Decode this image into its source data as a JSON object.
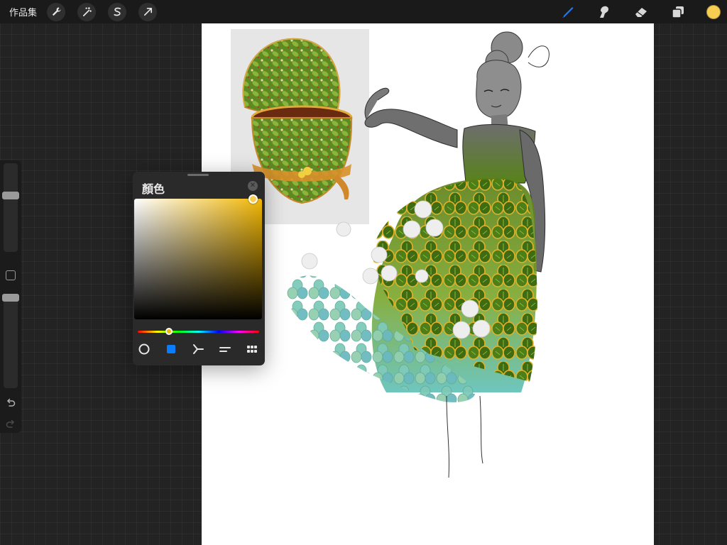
{
  "topbar": {
    "gallery_label": "作品集",
    "left_tools": [
      {
        "name": "wrench-icon",
        "label": "actions"
      },
      {
        "name": "magic-wand-icon",
        "label": "adjustments"
      },
      {
        "name": "selection-s-icon",
        "label": "selection"
      },
      {
        "name": "transform-arrow-icon",
        "label": "transform"
      }
    ],
    "right_tools": [
      {
        "name": "brush-icon",
        "active": true
      },
      {
        "name": "smudge-icon",
        "active": false
      },
      {
        "name": "eraser-icon",
        "active": false
      },
      {
        "name": "layers-icon",
        "active": false
      }
    ],
    "current_color": "#f7ce52"
  },
  "sidebar": {
    "brush_size_level": 0.35,
    "opacity_level": 0.0
  },
  "color_panel": {
    "title": "顏色",
    "hue_color": "#f2b705",
    "accent": "#0a7cff",
    "sv_handle": {
      "saturation": 0.93,
      "brightness": 1.0
    },
    "hue_position": 0.26,
    "modes": [
      {
        "name": "disc-mode-icon",
        "active": false
      },
      {
        "name": "classic-mode-icon",
        "active": true
      },
      {
        "name": "harmony-mode-icon",
        "active": false
      },
      {
        "name": "value-mode-icon",
        "active": false
      },
      {
        "name": "palettes-mode-icon",
        "active": false
      }
    ]
  }
}
